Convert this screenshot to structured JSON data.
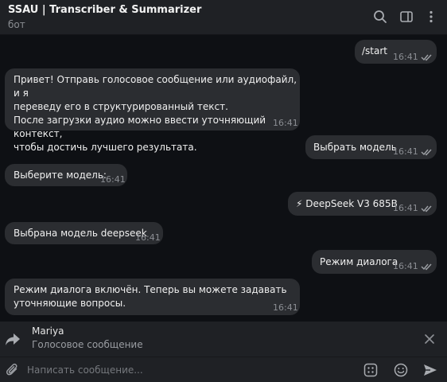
{
  "header": {
    "title": "SSAU | Transcriber & Summarizer",
    "subtitle": "бот"
  },
  "messages": [
    {
      "direction": "out",
      "text": "/start",
      "time": "16:41"
    },
    {
      "direction": "in",
      "text": "Привет! Отправь голосовое сообщение или аудиофайл, и я\nпереведу его в структурированный текст.\nПосле загрузки аудио можно ввести уточняющий контекст,\nчтобы достичь лучшего результата.",
      "time": "16:41"
    },
    {
      "direction": "out",
      "text": "Выбрать модель",
      "time": "16:41"
    },
    {
      "direction": "in",
      "text": "Выберите модель:",
      "time": "16:41"
    },
    {
      "direction": "out",
      "text": "⚡ DeepSeek V3 685B",
      "time": "16:41"
    },
    {
      "direction": "in",
      "text": "Выбрана модель deepseek",
      "time": "16:41"
    },
    {
      "direction": "out",
      "text": "Режим диалога",
      "time": "16:41"
    },
    {
      "direction": "in",
      "text": "Режим диалога включён. Теперь вы можете задавать\nуточняющие вопросы.",
      "time": "16:41"
    }
  ],
  "reply": {
    "name": "Mariya",
    "text": "Голосовое сообщение"
  },
  "composer": {
    "placeholder": "Написать сообщение..."
  },
  "colors": {
    "background": "#0e1014",
    "panel": "#1f2125",
    "bubble": "#2b2d31",
    "accent": "#8ab4f8"
  },
  "icons": [
    "search-icon",
    "sidebar-toggle-icon",
    "more-vert-icon",
    "forward-icon",
    "close-icon",
    "paperclip-icon",
    "commands-icon",
    "emoji-icon",
    "send-icon",
    "double-check-icon"
  ]
}
